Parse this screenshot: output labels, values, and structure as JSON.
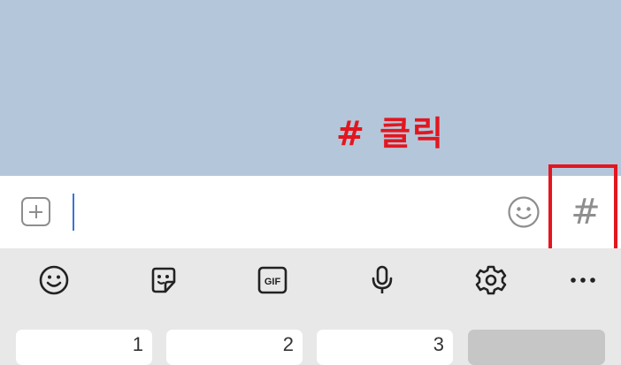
{
  "annotation": {
    "text": "# 클릭",
    "color": "#e3161f"
  },
  "input_bar": {
    "plus_icon": "plus-square-icon",
    "emoji_icon": "smiley-icon",
    "hashtag_label": "#",
    "input_value": "",
    "placeholder": ""
  },
  "toolbar": {
    "icons": [
      "emoji-icon",
      "sticker-icon",
      "gif-icon",
      "microphone-icon",
      "settings-gear-icon",
      "more-icon"
    ],
    "gif_label": "GIF"
  },
  "keyboard": {
    "keys": [
      "1",
      "2",
      "3",
      ""
    ]
  },
  "colors": {
    "chat_background": "#b4c7da",
    "highlight_red": "#e3161f",
    "caret_blue": "#3b74d6",
    "icon_gray": "#8e8e8e"
  }
}
